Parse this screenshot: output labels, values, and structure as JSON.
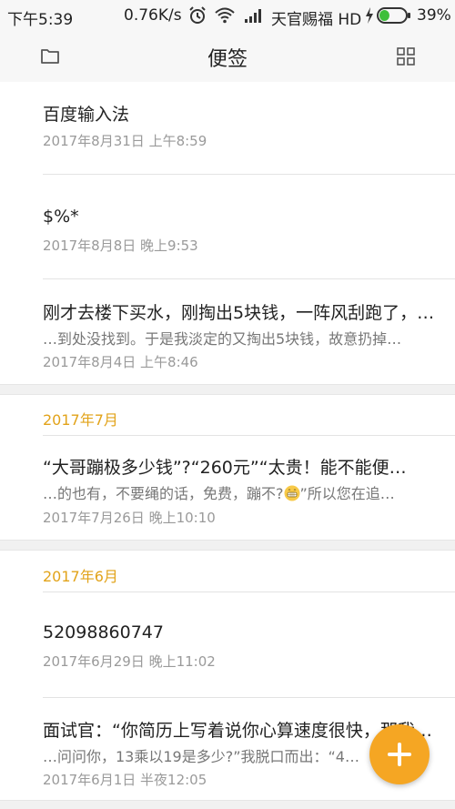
{
  "status_bar": {
    "time": "下午5:39",
    "speed": "0.76K/s",
    "carrier": "天官赐福 HD",
    "battery": "39%",
    "battery_level": 0.39
  },
  "header": {
    "title": "便签",
    "left_icon": "folder-icon",
    "right_icon": "grid-icon"
  },
  "notes": [
    {
      "title": "百度输入法",
      "snippet": "",
      "date": "2017年8月31日 上午8:59"
    },
    {
      "title": "$%*",
      "snippet": "",
      "date": "2017年8月8日 晚上9:53"
    },
    {
      "title": "刚才去楼下买水，刚掏出5块钱，一阵风刮跑了，…",
      "snippet": "…到处没找到。于是我淡定的又掏出5块钱，故意扔掉…",
      "date": "2017年8月4日 上午8:46"
    }
  ],
  "sections": [
    {
      "label": "2017年7月",
      "notes": [
        {
          "title": "“大哥蹦极多少钱”?“260元”“太贵！能不能便…",
          "snippet_before": "…的也有，不要绳的话，免费，蹦不?",
          "snippet_after": "”所以您在追…",
          "date": "2017年7月26日 晚上10:10"
        }
      ]
    },
    {
      "label": "2017年6月",
      "notes": [
        {
          "title": "52098860747",
          "snippet": "",
          "date": "2017年6月29日 晚上11:02"
        },
        {
          "title": "面试官：“你简历上写着说你心算速度很快，那我…",
          "snippet": "…问问你，13乘以19是多少?”我脱口而出：“4…",
          "date": "2017年6月1日 半夜12:05"
        }
      ]
    }
  ],
  "fab": {
    "icon": "plus-icon"
  },
  "colors": {
    "accent": "#f5a623",
    "section": "#e2a31a",
    "battery": "#3dbf3a"
  }
}
